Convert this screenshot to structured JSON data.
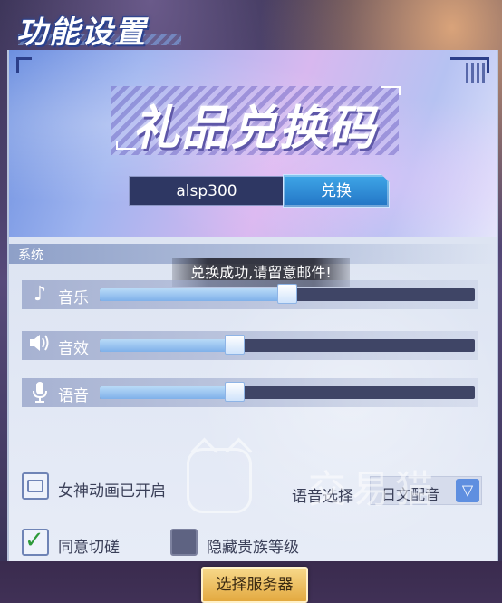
{
  "header": {
    "title": "功能设置"
  },
  "gift": {
    "title": "礼品兑换码",
    "code_value": "alsp300",
    "redeem_label": "兑换"
  },
  "settings": {
    "section_label": "系统",
    "toast": "兑换成功,请留意邮件!",
    "sliders": [
      {
        "icon": "music-note-icon",
        "label": "音乐",
        "level": 0.5
      },
      {
        "icon": "speaker-icon",
        "label": "音效",
        "level": 0.36
      },
      {
        "icon": "microphone-icon",
        "label": "语音",
        "level": 0.36
      }
    ],
    "goddess_anim_label": "女神动画已开启",
    "voice_select_label": "语音选择",
    "voice_select_value": "日文配音",
    "agree_spar_label": "同意切磋",
    "agree_spar_checked": true,
    "hide_noble_label": "隐藏贵族等级",
    "hide_noble_checked": false,
    "server_button_label": "选择服务器"
  },
  "watermark": {
    "text": "交易猫"
  },
  "colors": {
    "accent": "#2374c4",
    "toast_bg": "#1e1e28",
    "gold": "#e3a940"
  }
}
